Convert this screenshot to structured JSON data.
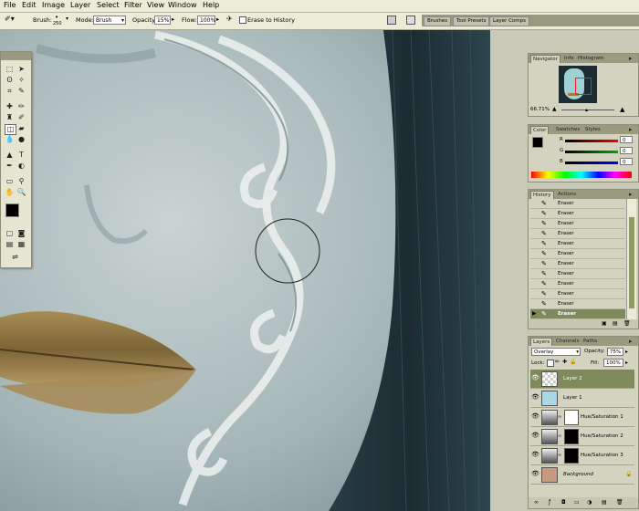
{
  "menu": [
    "File",
    "Edit",
    "Image",
    "Layer",
    "Select",
    "Filter",
    "View",
    "Window",
    "Help"
  ],
  "options": {
    "brush_label": "Brush:",
    "brush_size": "250",
    "mode_label": "Mode:",
    "mode_value": "Brush",
    "opacity_label": "Opacity:",
    "opacity_value": "15%",
    "flow_label": "Flow:",
    "flow_value": "100%",
    "erase_history_label": "Erase to History"
  },
  "well_tabs": [
    "Brushes",
    "Tool Presets",
    "Layer Comps"
  ],
  "navigator": {
    "tabs": [
      "Navigator",
      "Info",
      "Histogram"
    ],
    "zoom": "66.71%"
  },
  "color": {
    "tabs": [
      "Color",
      "Swatches",
      "Styles"
    ],
    "labels": [
      "R",
      "G",
      "B"
    ],
    "values": [
      "0",
      "0",
      "0"
    ]
  },
  "history": {
    "tabs": [
      "History",
      "Actions"
    ],
    "items": [
      "Eraser",
      "Eraser",
      "Eraser",
      "Eraser",
      "Eraser",
      "Eraser",
      "Eraser",
      "Eraser",
      "Eraser",
      "Eraser",
      "Eraser",
      "Eraser"
    ]
  },
  "layers": {
    "tabs": [
      "Layers",
      "Channels",
      "Paths"
    ],
    "blend_mode": "Overlay",
    "opacity_label": "Opacity:",
    "opacity": "75%",
    "lock_label": "Lock:",
    "fill_label": "Fill:",
    "fill": "100%",
    "items": [
      "Layer 2",
      "Layer 1",
      "Hue/Saturation 1",
      "Hue/Saturation 2",
      "Hue/Saturation 3",
      "Background"
    ]
  }
}
